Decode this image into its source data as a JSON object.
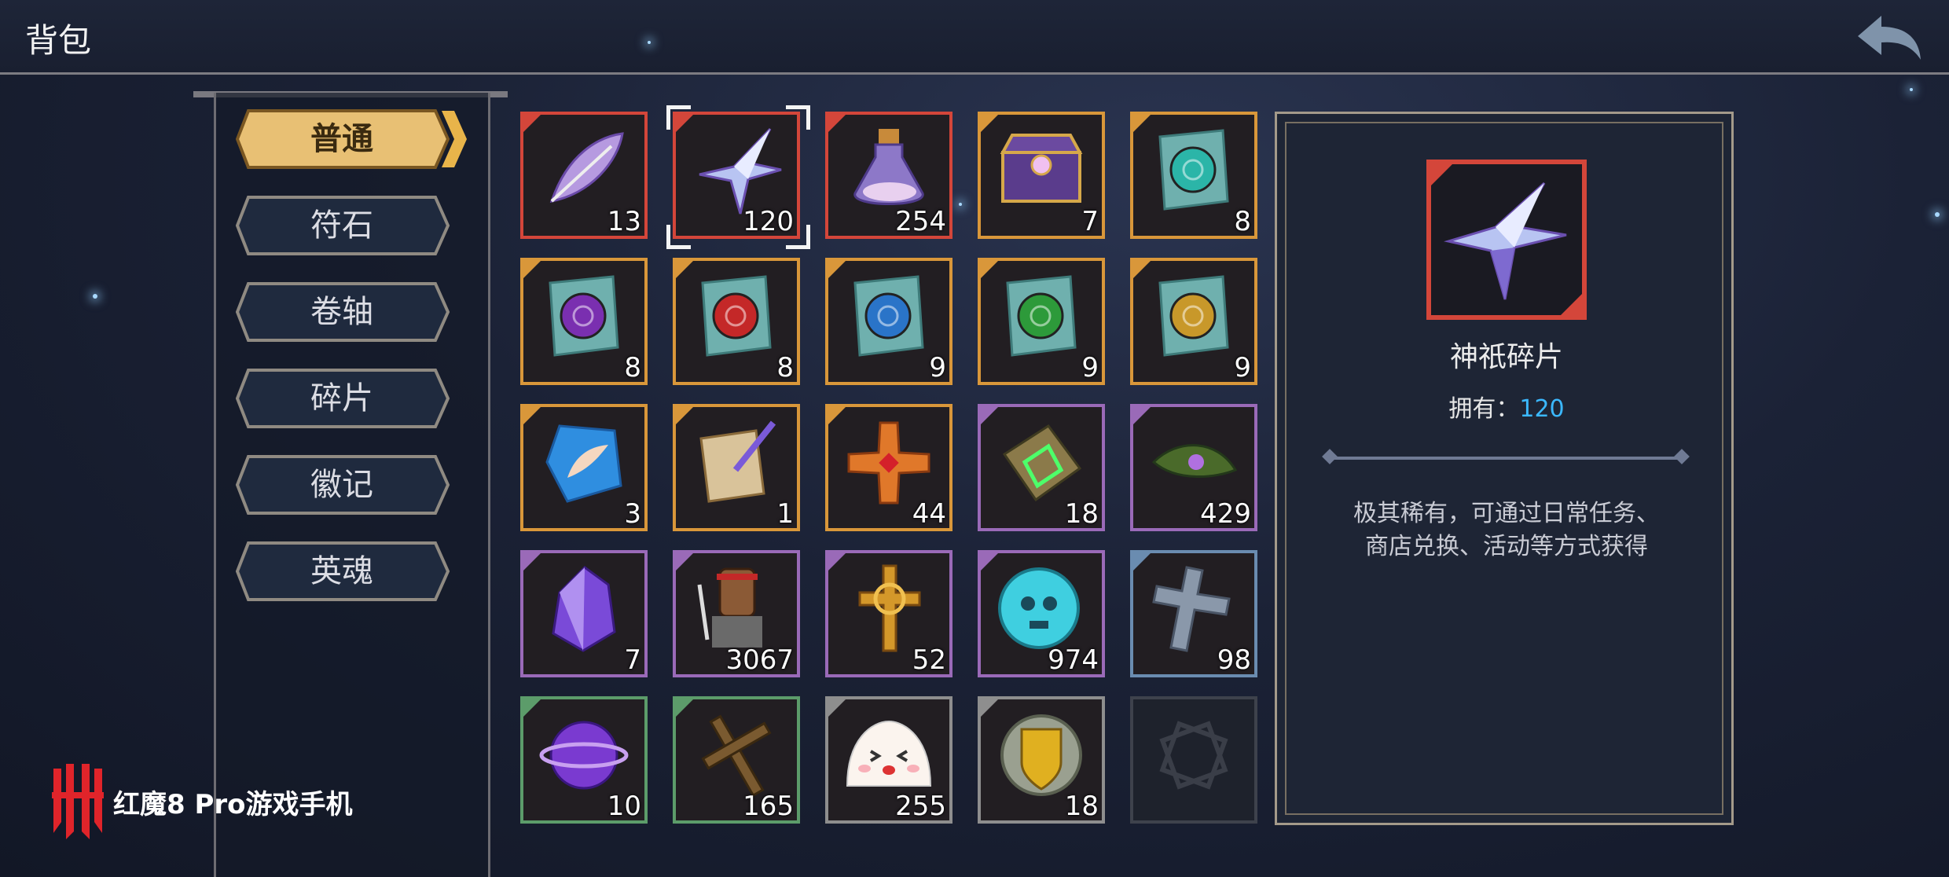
{
  "header": {
    "title": "背包"
  },
  "tabs": [
    {
      "label": "普通",
      "active": true
    },
    {
      "label": "符石",
      "active": false
    },
    {
      "label": "卷轴",
      "active": false
    },
    {
      "label": "碎片",
      "active": false
    },
    {
      "label": "徽记",
      "active": false
    },
    {
      "label": "英魂",
      "active": false
    }
  ],
  "grid": {
    "rows": [
      [
        {
          "icon": "crystal-feather-icon",
          "count": "13",
          "rarity": "red"
        },
        {
          "icon": "crystal-star-icon",
          "count": "120",
          "rarity": "red",
          "selected": true
        },
        {
          "icon": "potion-icon",
          "count": "254",
          "rarity": "red"
        },
        {
          "icon": "treasure-chest-icon",
          "count": "7",
          "rarity": "gold"
        },
        {
          "icon": "scroll-cyan-icon",
          "count": "8",
          "rarity": "gold"
        }
      ],
      [
        {
          "icon": "scroll-purple-icon",
          "count": "8",
          "rarity": "gold"
        },
        {
          "icon": "scroll-red-icon",
          "count": "8",
          "rarity": "gold"
        },
        {
          "icon": "scroll-blue-icon",
          "count": "9",
          "rarity": "gold"
        },
        {
          "icon": "scroll-green-icon",
          "count": "9",
          "rarity": "gold"
        },
        {
          "icon": "scroll-gold-icon",
          "count": "9",
          "rarity": "gold"
        }
      ],
      [
        {
          "icon": "wing-emblem-icon",
          "count": "3",
          "rarity": "gold"
        },
        {
          "icon": "quill-scroll-icon",
          "count": "1",
          "rarity": "gold"
        },
        {
          "icon": "ruby-cross-icon",
          "count": "44",
          "rarity": "gold"
        },
        {
          "icon": "green-rune-plank-icon",
          "count": "18",
          "rarity": "purple"
        },
        {
          "icon": "leaf-gem-icon",
          "count": "429",
          "rarity": "purple"
        }
      ],
      [
        {
          "icon": "purple-crystal-icon",
          "count": "7",
          "rarity": "purple"
        },
        {
          "icon": "wooden-warrior-icon",
          "count": "3067",
          "rarity": "purple"
        },
        {
          "icon": "golden-cross-icon",
          "count": "52",
          "rarity": "purple"
        },
        {
          "icon": "skull-emblem-icon",
          "count": "974",
          "rarity": "purple"
        },
        {
          "icon": "stone-cross-icon",
          "count": "98",
          "rarity": "blue"
        }
      ],
      [
        {
          "icon": "purple-orb-icon",
          "count": "10",
          "rarity": "green"
        },
        {
          "icon": "wooden-cross-icon",
          "count": "165",
          "rarity": "green"
        },
        {
          "icon": "slime-face-icon",
          "count": "255",
          "rarity": "gray"
        },
        {
          "icon": "gold-shield-icon",
          "count": "18",
          "rarity": "gray"
        },
        {
          "icon": "empty-slot-icon",
          "count": "",
          "rarity": "empty"
        }
      ]
    ]
  },
  "detail": {
    "name": "神祇碎片",
    "owned_label": "拥有：",
    "owned_value": "120",
    "desc_line1": "极其稀有，可通过日常任务、",
    "desc_line2": "商店兑换、活动等方式获得"
  },
  "brand": {
    "text": "红魔8 Pro游戏手机"
  },
  "colors": {
    "red": "#d4463a",
    "gold": "#d9973a",
    "purple": "#9a6ab8",
    "blue": "#6a8cb0",
    "green": "#5c9c6a",
    "gray": "#8e8e8e",
    "empty": "#3e424c",
    "owned_value": "#3bb8ff"
  }
}
